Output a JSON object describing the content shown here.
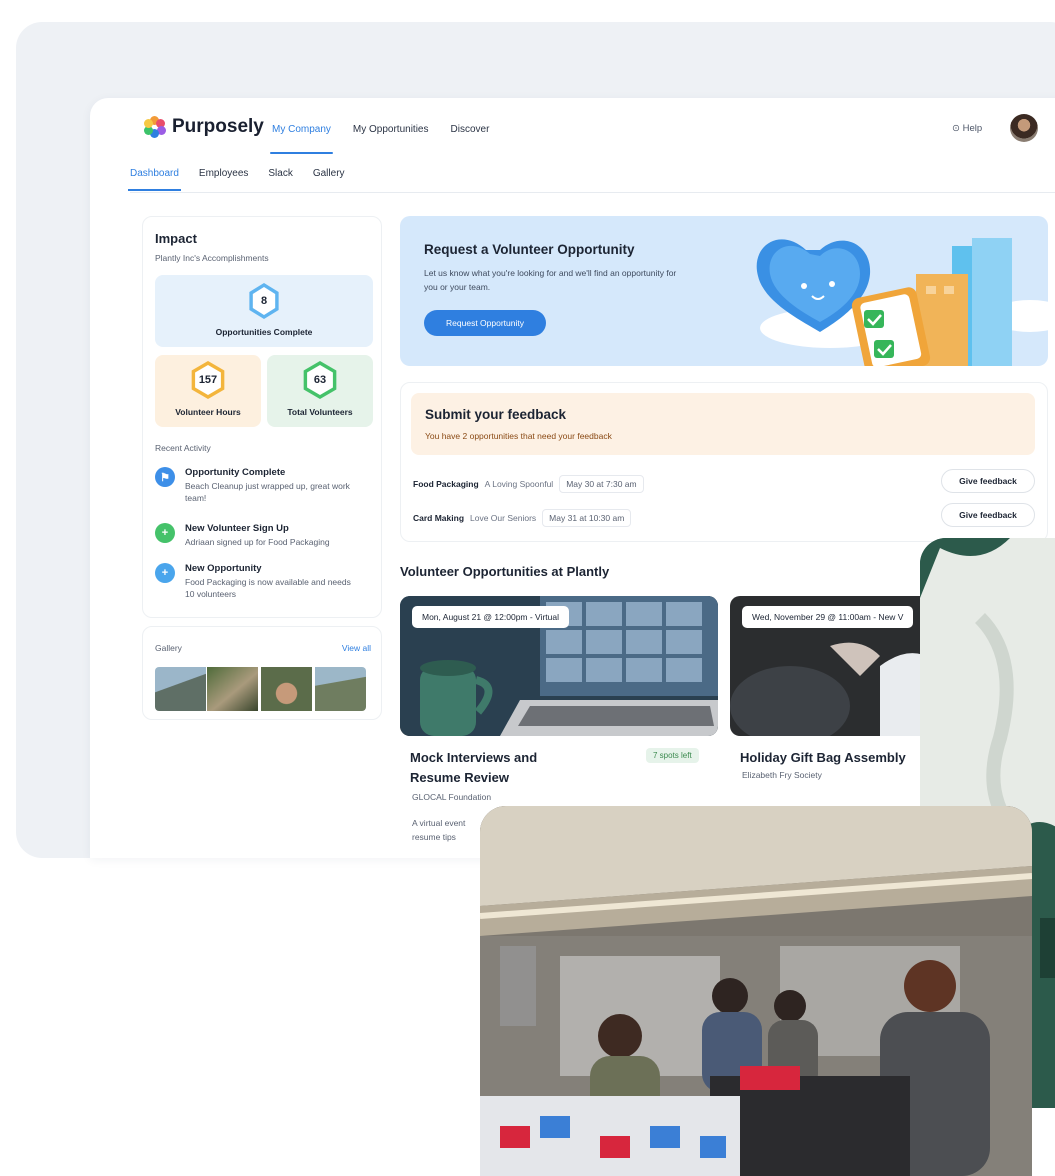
{
  "brand": {
    "name": "Purposely"
  },
  "topnav": {
    "items": [
      "My Company",
      "My Opportunities",
      "Discover"
    ],
    "help": "Help"
  },
  "subnav": {
    "items": [
      "Dashboard",
      "Employees",
      "Slack",
      "Gallery"
    ]
  },
  "impact": {
    "title": "Impact",
    "subtitle": "Plantly Inc's Accomplishments",
    "opportunities": {
      "value": "8",
      "label": "Opportunities Complete"
    },
    "hours": {
      "value": "157",
      "label": "Volunteer Hours"
    },
    "volunteers": {
      "value": "63",
      "label": "Total Volunteers"
    },
    "recent_title": "Recent Activity",
    "activities": [
      {
        "title": "Opportunity Complete",
        "desc": "Beach Cleanup just wrapped up, great work team!"
      },
      {
        "title": "New Volunteer Sign Up",
        "desc": "Adriaan signed up for Food Packaging"
      },
      {
        "title": "New Opportunity",
        "desc": "Food Packaging is now available and needs 10 volunteers"
      }
    ]
  },
  "gallery": {
    "title": "Gallery",
    "view_all": "View all"
  },
  "request": {
    "title": "Request a Volunteer Opportunity",
    "desc": "Let us know what you're looking for and we'll find an opportunity for you or your team.",
    "button": "Request Opportunity"
  },
  "feedback": {
    "title": "Submit your feedback",
    "desc": "You have 2 opportunities that need your feedback",
    "rows": [
      {
        "name": "Food Packaging",
        "org": "A Loving Spoonful",
        "date": "May 30 at 7:30 am",
        "button": "Give feedback"
      },
      {
        "name": "Card Making",
        "org": "Love Our Seniors",
        "date": "May 31 at 10:30 am",
        "button": "Give feedback"
      }
    ]
  },
  "opportunities": {
    "title": "Volunteer Opportunities at Plantly",
    "cards": [
      {
        "date": "Mon, August 21 @ 12:00pm - Virtual",
        "title_line1": "Mock Interviews and",
        "title_line2": "Resume Review",
        "org": "GLOCAL Foundation",
        "spots": "7 spots left",
        "desc_line1": "A virtual event",
        "desc_line2": "resume tips"
      },
      {
        "date": "Wed, November 29 @ 11:00am - New V",
        "title_line1": "Holiday Gift Bag Assembly",
        "org": "Elizabeth Fry Society"
      }
    ]
  },
  "colors": {
    "accent": "#2f7fe0",
    "request_bg": "#d5e8fb",
    "feedback_bg": "#fdf1e4"
  }
}
